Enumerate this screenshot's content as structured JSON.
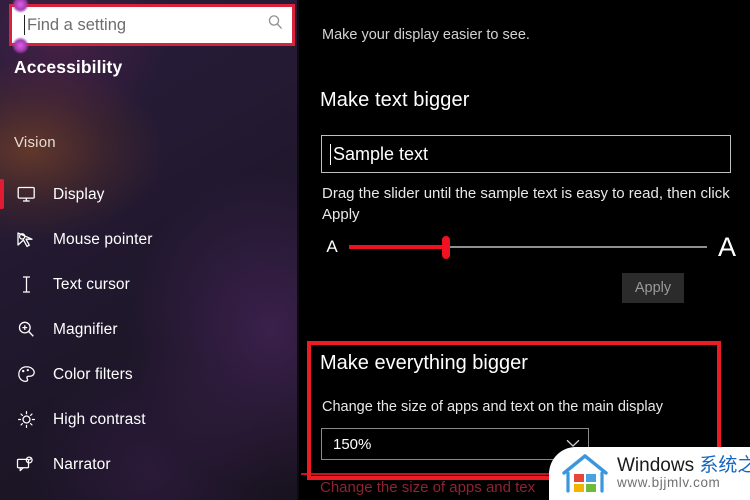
{
  "sidebar": {
    "search": {
      "placeholder": "Find a setting",
      "value": "",
      "icon": "search-icon"
    },
    "page_title": "Accessibility",
    "group_header": "Vision",
    "items": [
      {
        "label": "Display",
        "icon": "monitor-icon",
        "selected": true
      },
      {
        "label": "Mouse pointer",
        "icon": "mouse-pointer-icon",
        "selected": false
      },
      {
        "label": "Text cursor",
        "icon": "text-cursor-icon",
        "selected": false
      },
      {
        "label": "Magnifier",
        "icon": "magnifier-icon",
        "selected": false
      },
      {
        "label": "Color filters",
        "icon": "palette-icon",
        "selected": false
      },
      {
        "label": "High contrast",
        "icon": "brightness-icon",
        "selected": false
      },
      {
        "label": "Narrator",
        "icon": "narrator-icon",
        "selected": false
      }
    ]
  },
  "main": {
    "intro_text": "Make your display easier to see.",
    "make_text_bigger": {
      "title": "Make text bigger",
      "sample_text": "Sample text",
      "help_text": "Drag the slider until the sample text is easy to read, then click Apply",
      "slider": {
        "min_label": "A",
        "max_label": "A",
        "value_percent": 27
      },
      "apply_label": "Apply"
    },
    "make_everything_bigger": {
      "title": "Make everything bigger",
      "description": "Change the size of apps and text on the main display",
      "scale_value": "150%",
      "chevron_icon": "chevron-down-icon"
    },
    "bottom_text": "Change the size of apps and tex"
  },
  "watermark": {
    "brand_en": "Windows ",
    "brand_cn": "系统之家",
    "url": "www.bjjmlv.com",
    "logo_icon": "windows-house-logo-icon"
  },
  "colors": {
    "highlight_red": "#ec1c24",
    "search_border_red": "#d8213a",
    "slider_red": "#f01122",
    "selection_red": "#e11b32",
    "sidebar_base": "#241a33",
    "main_bg": "#000000"
  }
}
